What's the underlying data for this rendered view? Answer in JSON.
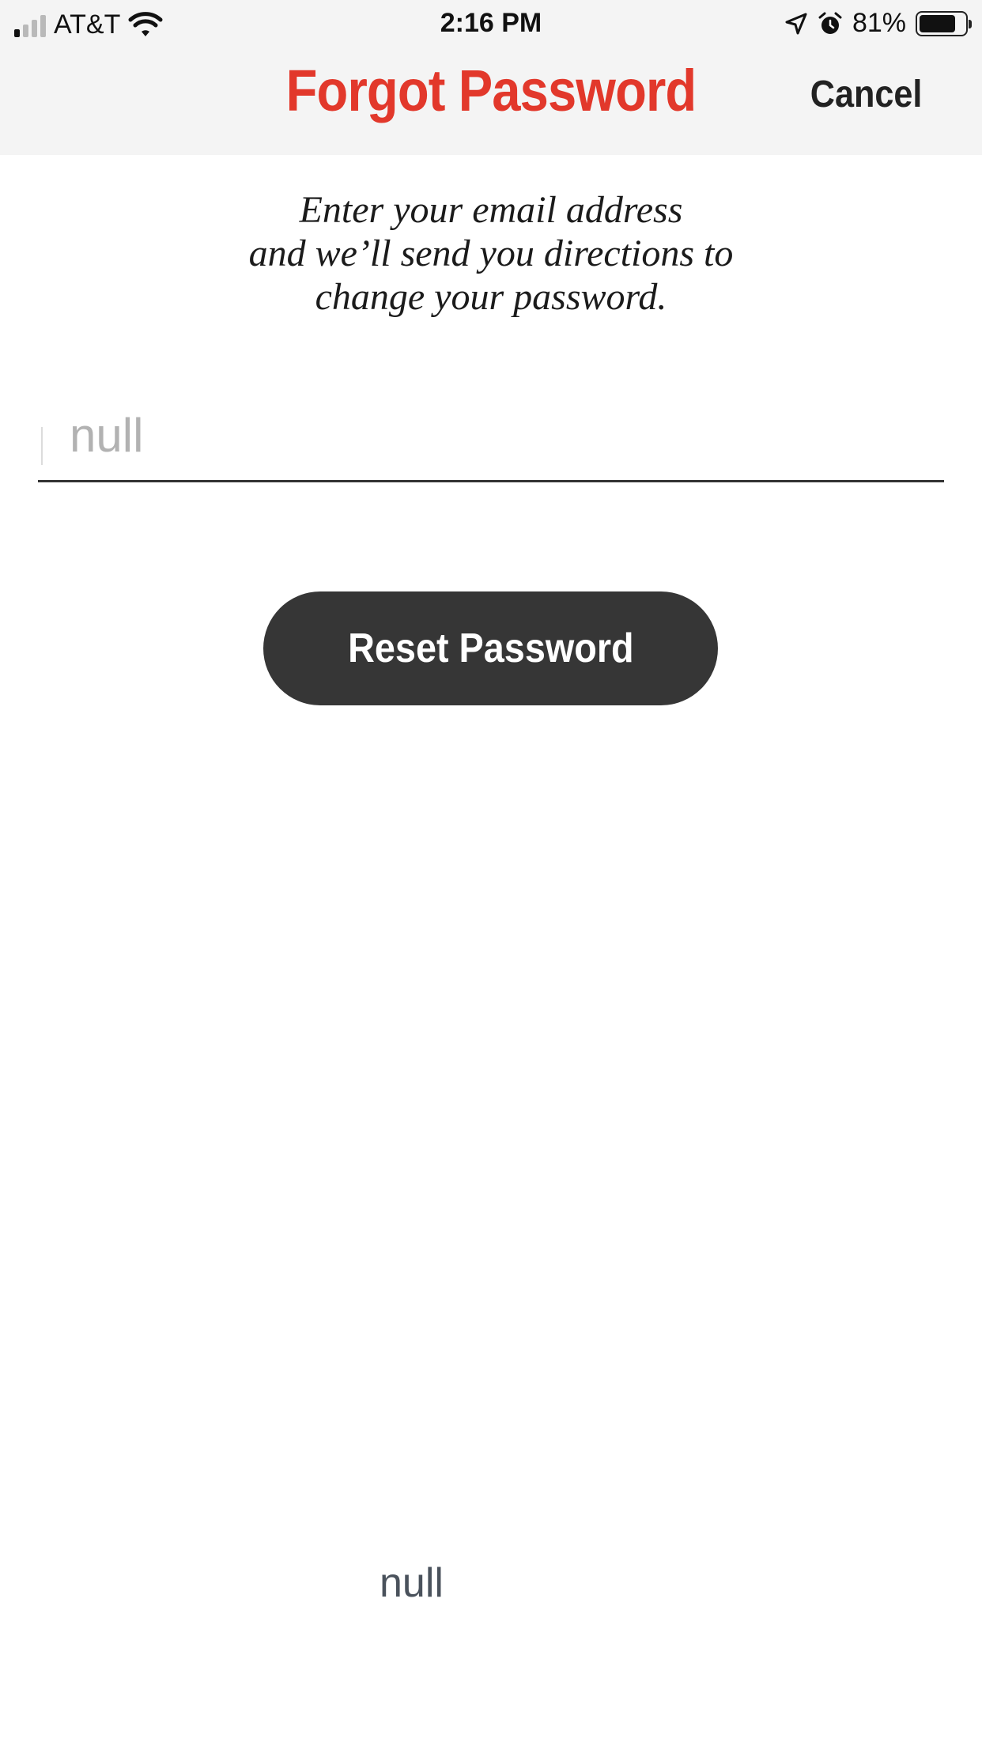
{
  "status_bar": {
    "carrier": "AT&T",
    "signal_bars_active": 1,
    "time": "2:16 PM",
    "battery_percent": "81%",
    "battery_level": 0.81,
    "icons": [
      "signal-icon",
      "wifi-icon",
      "location-icon",
      "alarm-icon",
      "battery-icon"
    ]
  },
  "nav": {
    "title": "Forgot Password",
    "cancel_label": "Cancel"
  },
  "main": {
    "instructions": "Enter your email address\nand we’ll send you directions to\nchange your password.",
    "email": {
      "value": "",
      "placeholder": "null"
    },
    "reset_label": "Reset Password",
    "footer_text": "null"
  },
  "colors": {
    "accent": "#E2382B",
    "button": "#363636",
    "bar_background": "#F4F4F4"
  }
}
